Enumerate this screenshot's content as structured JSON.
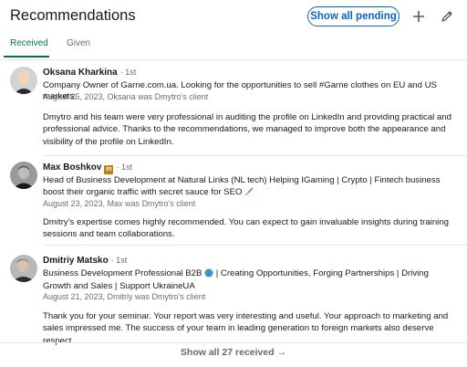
{
  "header": {
    "title": "Recommendations",
    "pending_label": "Show all pending",
    "add_icon": "plus-icon",
    "edit_icon": "pencil-icon"
  },
  "tabs": [
    {
      "label": "Received",
      "active": true
    },
    {
      "label": "Given",
      "active": false
    }
  ],
  "recommendations": [
    {
      "name": "Oksana Kharkina",
      "degree": "· 1st",
      "headline": "Company Owner of Garne.com.ua. Looking for the opportunities to sell #Garne clothes on EU and US markets.",
      "meta": "August 25, 2023, Oksana was Dmytro's client",
      "text": "Dmytro and his team were very professional in auditing the profile on LinkedIn and providing practical and professional advice. Thanks to the recommendations, we managed to improve both the appearance and visibility of the profile on LinkedIn."
    },
    {
      "name": "Max Boshkov",
      "degree": "· 1st",
      "badge": "in",
      "headline": "Head of Business Development at Natural Links (NL tech) Helping IGaming | Crypto | Fintech business boost their organic traffic with secret sauce for SEO",
      "meta": "August 23, 2023, Max was Dmytro's client",
      "text": "Dmitry's expertise comes highly recommended. You can expect to gain invaluable insights during training sessions and team collaborations."
    },
    {
      "name": "Dmitriy Matsko",
      "degree": "· 1st",
      "headline_a": "Business Development Professional B2B",
      "headline_b": "| Creating Opportunities, Forging Partnerships | Driving Growth and Sales | Support UkraineUA",
      "meta": "August 21, 2023, Dmitriy was Dmytro's client",
      "text": "Thank you for your seminar. Your report was very interesting and useful. Your approach to marketing and sales impressed me. The success of your team in leading generation to foreign markets also deserve respect."
    }
  ],
  "footer": {
    "show_all_label": "Show all 27 received →"
  },
  "colors": {
    "accent_blue": "#0a66c2",
    "tab_green": "#01754f",
    "linkedin_badge": "#c37d16"
  }
}
